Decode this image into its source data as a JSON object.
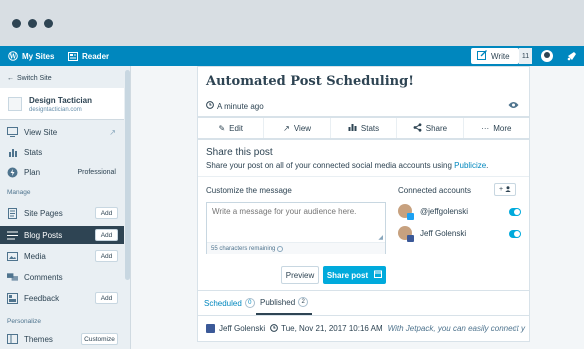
{
  "browser": {
    "dots": [
      "close",
      "minimize",
      "maximize"
    ]
  },
  "masterbar": {
    "my_sites": "My Sites",
    "reader": "Reader",
    "write": "Write",
    "notification_count": "11"
  },
  "sidebar": {
    "switch_site": "Switch Site",
    "site_name": "Design Tactician",
    "site_url": "designtactician.com",
    "view_site": "View Site",
    "stats": "Stats",
    "plan": "Plan",
    "plan_value": "Professional",
    "manage_heading": "Manage",
    "site_pages": "Site Pages",
    "blog_posts": "Blog Posts",
    "media": "Media",
    "comments": "Comments",
    "feedback": "Feedback",
    "personalize_heading": "Personalize",
    "themes": "Themes",
    "add_label": "Add",
    "customize_label": "Customize"
  },
  "post": {
    "title": "Automated Post Scheduling!",
    "time": "A minute ago"
  },
  "actions": {
    "edit": "Edit",
    "view": "View",
    "stats": "Stats",
    "share": "Share",
    "more": "More"
  },
  "share": {
    "heading": "Share this post",
    "description": "Share your post on all of your connected social media accounts using",
    "publicize": "Publicize",
    "period": ".",
    "customize_label": "Customize the message",
    "placeholder": "Write a message for your audience here.",
    "chars_remaining": "55 characters remaining",
    "preview": "Preview",
    "share_post": "Share post",
    "connected_label": "Connected accounts",
    "add_account": "+",
    "accounts": [
      {
        "name": "@jeffgolenski",
        "network": "twitter",
        "enabled": true
      },
      {
        "name": "Jeff Golenski",
        "network": "facebook",
        "enabled": true
      }
    ]
  },
  "tabs": {
    "scheduled": "Scheduled",
    "scheduled_count": "0",
    "published": "Published",
    "published_count": "2"
  },
  "published_item": {
    "author": "Jeff Golenski",
    "date": "Tue, Nov 21, 2017 10:16 AM",
    "message": "With Jetpack, you can easily connect y"
  },
  "colors": {
    "brand": "#0087be",
    "accent": "#00aadc",
    "text": "#2e4453",
    "link": "#0087be"
  }
}
